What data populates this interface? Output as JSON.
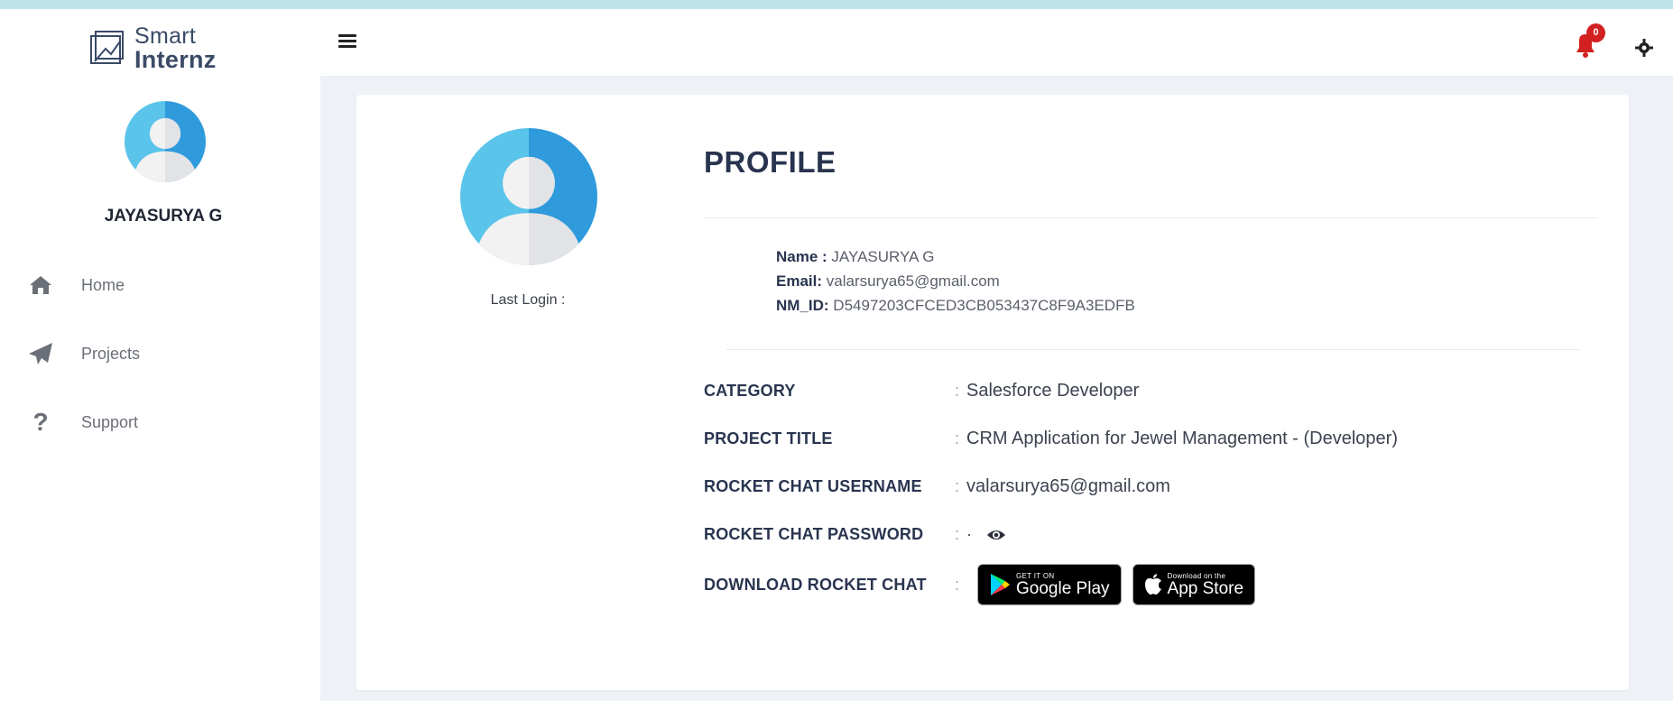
{
  "brand": {
    "line1": "Smart",
    "line2": "Internz"
  },
  "user": {
    "name": "JAYASURYA G"
  },
  "nav": [
    {
      "label": "Home",
      "icon": "home-icon"
    },
    {
      "label": "Projects",
      "icon": "paper-plane-icon"
    },
    {
      "label": "Support",
      "icon": "question-icon"
    }
  ],
  "topbar": {
    "notification_count": "0"
  },
  "profile": {
    "title": "PROFILE",
    "last_login_label": "Last Login :",
    "name_label": "Name :",
    "name_value": "JAYASURYA G",
    "email_label": "Email:",
    "email_value": "valarsurya65@gmail.com",
    "nmid_label": "NM_ID:",
    "nmid_value": "D5497203CFCED3CB053437C8F9A3EDFB"
  },
  "details": [
    {
      "label": "CATEGORY",
      "value": "Salesforce Developer"
    },
    {
      "label": "PROJECT TITLE",
      "value": "CRM Application for Jewel Management - (Developer)"
    },
    {
      "label": "ROCKET CHAT USERNAME",
      "value": "valarsurya65@gmail.com"
    },
    {
      "label": "ROCKET CHAT PASSWORD",
      "value": "·"
    },
    {
      "label": "DOWNLOAD ROCKET CHAT",
      "value": ""
    }
  ],
  "stores": {
    "google_small": "GET IT ON",
    "google_big": "Google Play",
    "apple_small": "Download on the",
    "apple_big": "App Store"
  },
  "colors": {
    "accent": "#29344f",
    "avatar_blue": "#3aa3e0",
    "badge": "#d32121",
    "page_bg": "#eef1f6"
  }
}
